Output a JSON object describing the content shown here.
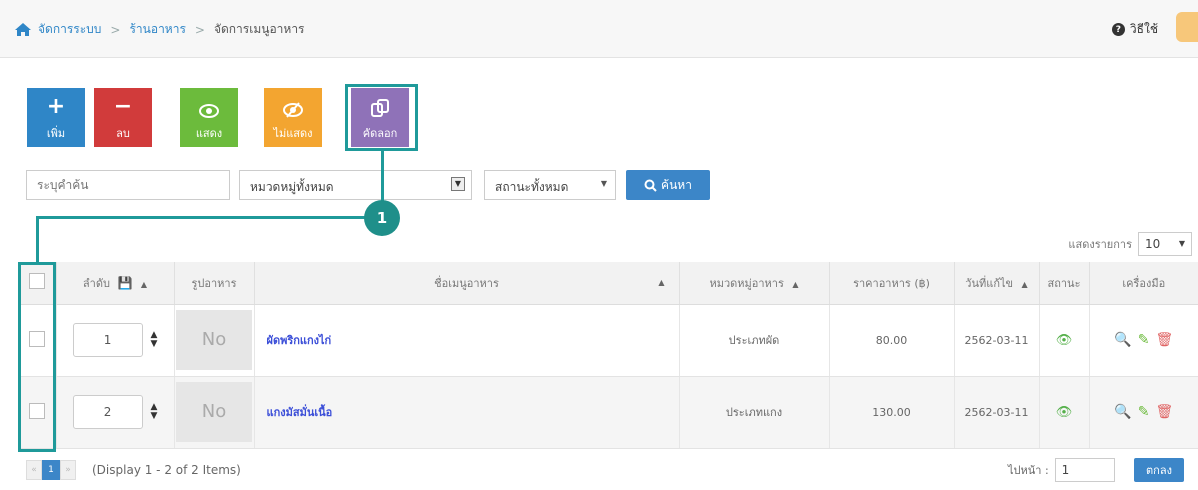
{
  "breadcrumb": {
    "items": [
      "จัดการระบบ",
      "ร้านอาหาร",
      "จัดการเมนูอาหาร"
    ],
    "separator": ">"
  },
  "help": {
    "label": "วิธีใช้"
  },
  "toolbar": {
    "add_label": "เพิ่ม",
    "delete_label": "ลบ",
    "show_label": "แสดง",
    "hide_label": "ไม่แสดง",
    "copy_label": "คัดลอก"
  },
  "filters": {
    "keyword_placeholder": "ระบุคำค้น",
    "category_value": "หมวดหมู่ทั้งหมด",
    "status_value": "สถานะทั้งหมด",
    "search_label": "ค้นหา"
  },
  "callout": {
    "number": "1"
  },
  "page_size": {
    "label": "แสดงรายการ",
    "value": "10"
  },
  "table": {
    "columns": {
      "order": "ลำดับ",
      "image": "รูปอาหาร",
      "name": "ชื่อเมนูอาหาร",
      "category": "หมวดหมู่อาหาร",
      "price": "ราคาอาหาร (฿)",
      "date": "วันที่แก้ไข",
      "status": "สถานะ",
      "tools": "เครื่องมือ"
    },
    "rows": [
      {
        "order": "1",
        "image": "No",
        "name": "ผัดพริกแกงไก่",
        "category": "ประเภทผัด",
        "price": "80.00",
        "date": "2562-03-11"
      },
      {
        "order": "2",
        "image": "No",
        "name": "แกงมัสมั่นเนื้อ",
        "category": "ประเภทแกง",
        "price": "130.00",
        "date": "2562-03-11"
      }
    ]
  },
  "pagination": {
    "prev": "«",
    "current": "1",
    "next": "»",
    "display": "(Display 1 - 2 of 2 Items)",
    "goto_label": "ไปหน้า :",
    "goto_value": "1",
    "go_button": "ตกลง"
  },
  "colors": {
    "add": "#2f86c7",
    "delete": "#d13b3b",
    "show": "#6cbb3c",
    "hide": "#f3a530",
    "copy": "#8f72b8",
    "highlight": "#1f9a9a"
  }
}
